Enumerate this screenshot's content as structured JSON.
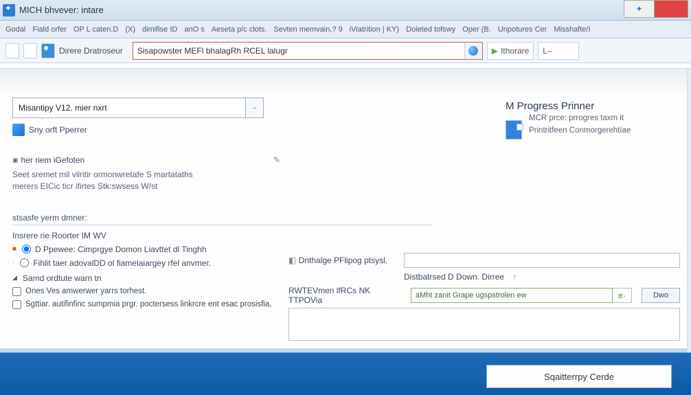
{
  "titlebar": {
    "title": "MICH bhvever: intare"
  },
  "menubar": {
    "items": [
      "Godal",
      "Fiald orfer",
      "OP L caten.D",
      "(X)",
      "dimifise ID",
      "anO s",
      "Aeseta p/c clots.",
      "Sevten memvain,? 9",
      "iViatrition | KY)",
      "Doieted tofswy",
      "Oper (B.",
      "Unpotures Cer",
      "Misshafte/I"
    ]
  },
  "toolbar": {
    "browse_label": "Direre Dratroseur",
    "address_value": "Sisapowster MEFl bhalagRh RCEL lalugr",
    "forward_label": "Ithorare"
  },
  "left": {
    "display_value": "Misantipy V12. mier nxrt",
    "say_label": "Sny orft Pperrer",
    "section_title": "her riem iGefoten",
    "desc_line1": "Seet sremet mil vilritir ormonwretafe S martataths",
    "desc_line2": "merers EICic ticr ifirtes Stk:swsess  W/st",
    "group_header": "stsasfe yerm dmner:",
    "sub_label": "Insrere rie Roorter IM WV",
    "radio1": "D Ppewee: Cimprgye Domon Liavttet dl Tinghh",
    "radio2": "Fihlit taer adovalDD ol fiamelaiargey rfel anvmer.",
    "sec2": "Samd ordtute warn tn",
    "chk1": "Ones Ves amwerwer yarrs torhest.",
    "chk2": "Sgttiar. autifinfinc sumpmia prgr. poctersess linkrcre ent esac prosisfia,"
  },
  "right": {
    "title": "M Progress Prinner",
    "sub1": "MCR prce: prrogres taxm it",
    "sub2": "Printritfeen Conmorgerehtíae"
  },
  "mini": {
    "label1": "Dnthalge PFlipog ptsysl,",
    "label2": "Distbatrsed D Down. Dirree",
    "label3": "RWTEVmen lfRCs NK TTPOVia",
    "select_value": "aMht zanit Grape ugspstrolen ew",
    "btn": "Dwo"
  },
  "footer": {
    "btn": "Sqaitterrpy Cerde"
  }
}
